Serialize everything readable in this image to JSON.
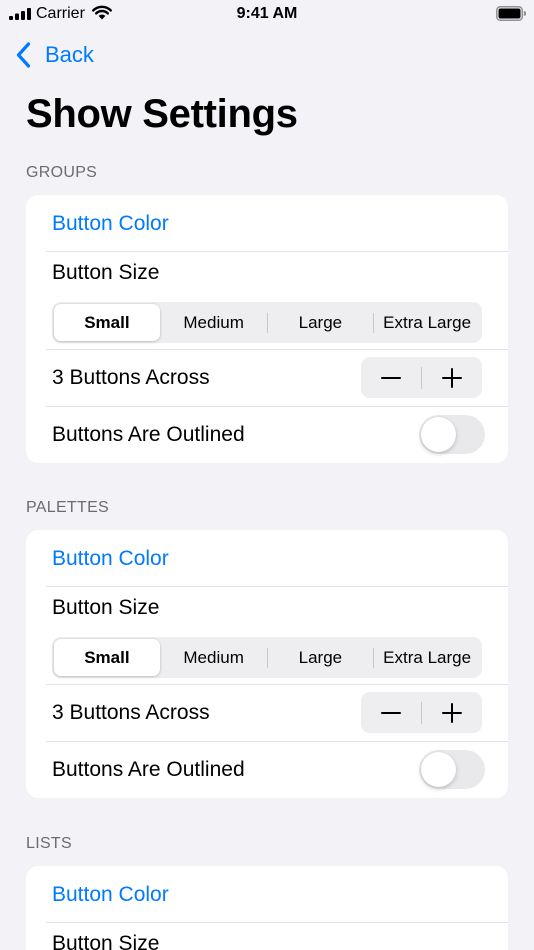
{
  "status_bar": {
    "carrier": "Carrier",
    "time": "9:41 AM"
  },
  "nav": {
    "back_label": "Back"
  },
  "page": {
    "title": "Show Settings"
  },
  "sections": [
    {
      "header": "GROUPS",
      "button_color_label": "Button Color",
      "button_size_label": "Button Size",
      "segments": [
        "Small",
        "Medium",
        "Large",
        "Extra Large"
      ],
      "selected_segment": "Small",
      "across_label": "3 Buttons Across",
      "outlined_label": "Buttons Are Outlined",
      "outlined_on": false
    },
    {
      "header": "PALETTES",
      "button_color_label": "Button Color",
      "button_size_label": "Button Size",
      "segments": [
        "Small",
        "Medium",
        "Large",
        "Extra Large"
      ],
      "selected_segment": "Small",
      "across_label": "3 Buttons Across",
      "outlined_label": "Buttons Are Outlined",
      "outlined_on": false
    },
    {
      "header": "LISTS",
      "button_color_label": "Button Color",
      "button_size_label": "Button Size"
    }
  ],
  "colors": {
    "accent": "#007AFF",
    "background": "#F2F2F7",
    "card": "#FFFFFF",
    "section_header": "#6C6C70",
    "toggle_off": "#E9E9EB"
  }
}
